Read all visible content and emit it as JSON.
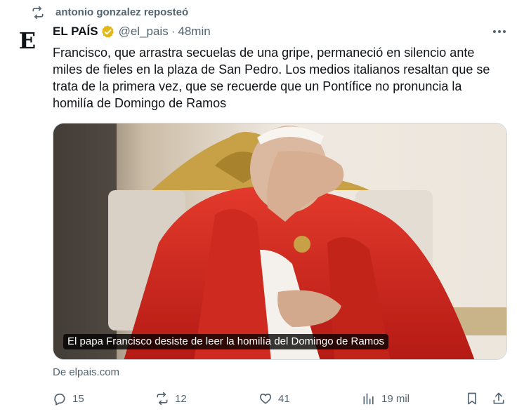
{
  "repost": {
    "icon": "repost-icon",
    "text": "antonio gonzalez reposteó"
  },
  "author": {
    "avatar_letter": "E",
    "name": "EL PAÍS",
    "verified_icon": "verified-badge-icon",
    "handle": "@el_pais",
    "separator": "·",
    "time": "48min"
  },
  "tweet": {
    "text": "Francisco, que arrastra secuelas de una gripe, permaneció en silencio ante miles de fieles en la plaza de San Pedro. Los medios italianos resaltan que se trata de la primera vez, que se recuerde que un Pontífice no pronuncia la homilía de Domingo de Ramos"
  },
  "card": {
    "caption": "El papa Francisco desiste de leer la homilía del Domingo de Ramos",
    "source": "De elpais.com"
  },
  "actions": {
    "replies": "15",
    "reposts": "12",
    "likes": "41",
    "views": "19 mil"
  },
  "colors": {
    "text": "#0f1419",
    "secondary": "#536471",
    "verified_gold": "#e2b719",
    "vestment_red": "#d4261c"
  }
}
